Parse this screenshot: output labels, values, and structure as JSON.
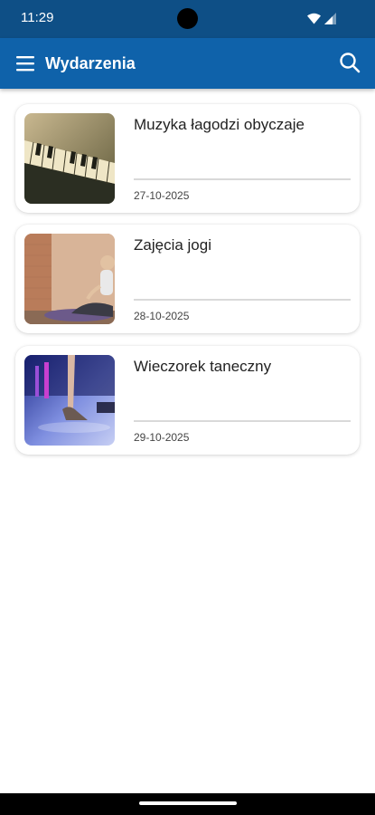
{
  "status_bar": {
    "time": "11:29"
  },
  "app_bar": {
    "title": "Wydarzenia"
  },
  "events": [
    {
      "title": "Muzyka łagodzi obyczaje",
      "date": "27-10-2025",
      "image": "piano-keys-photo"
    },
    {
      "title": "Zajęcia jogi",
      "date": "28-10-2025",
      "image": "yoga-woman-photo"
    },
    {
      "title": "Wieczorek taneczny",
      "date": "29-10-2025",
      "image": "dance-floor-photo"
    }
  ],
  "colors": {
    "status_bar": "#0e4f86",
    "app_bar": "#0f62aa",
    "background": "#ffffff"
  }
}
